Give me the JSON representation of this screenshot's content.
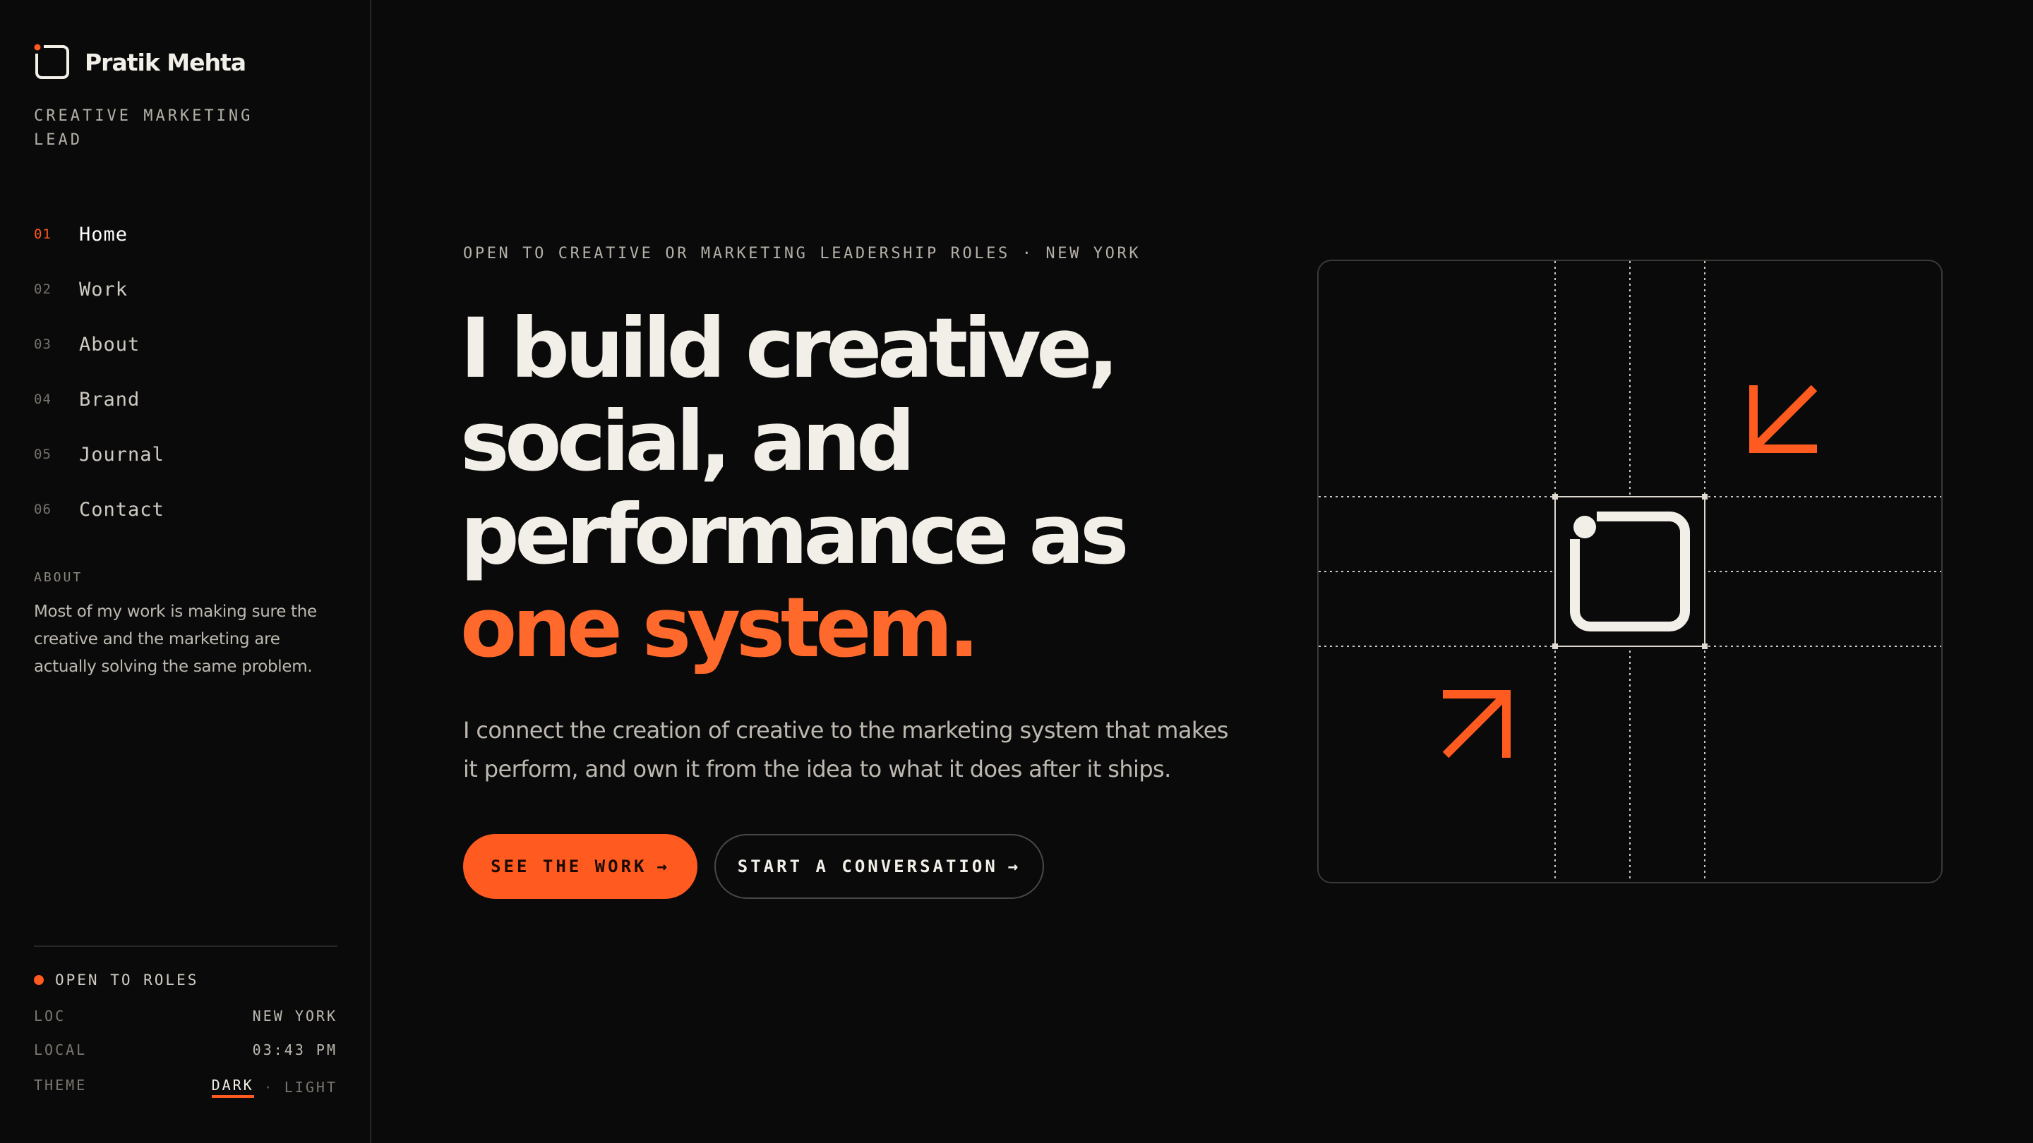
{
  "brand": {
    "name": "Pratik Mehta",
    "role": "CREATIVE MARKETING LEAD"
  },
  "nav": [
    {
      "num": "01",
      "label": "Home",
      "active": true
    },
    {
      "num": "02",
      "label": "Work"
    },
    {
      "num": "03",
      "label": "About"
    },
    {
      "num": "04",
      "label": "Brand"
    },
    {
      "num": "05",
      "label": "Journal"
    },
    {
      "num": "06",
      "label": "Contact"
    }
  ],
  "about": {
    "heading": "ABOUT",
    "text": "Most of my work is making sure the creative and the marketing are actually solving the same problem."
  },
  "status": {
    "label": "OPEN TO ROLES",
    "loc_key": "LOC",
    "loc_val": "NEW YORK",
    "local_key": "LOCAL",
    "local_val": "03:43 PM",
    "theme_key": "THEME",
    "theme_dark": "DARK",
    "theme_sep": "·",
    "theme_light": "LIGHT"
  },
  "hero": {
    "eyebrow": "OPEN TO CREATIVE OR MARKETING LEADERSHIP ROLES · NEW YORK",
    "line1": "I build creative,",
    "line2": "social, and",
    "line3": "performance as",
    "line4": "one system.",
    "lead": "I connect the creation of creative to the marketing system that makes it perform, and own it from the idea to what it does after it ships.",
    "primary_cta": "SEE THE WORK",
    "secondary_cta": "START A CONVERSATION",
    "arrow": "→"
  },
  "colors": {
    "accent": "#ff5a1f",
    "headline_accent": "#ff6a2c",
    "background": "#0a0a0a",
    "text": "#f2efe8"
  },
  "icons": {
    "logo": "logo-mark-icon",
    "arrow_in_top": "arrow-down-left-icon",
    "arrow_in_bottom": "arrow-up-right-icon"
  }
}
